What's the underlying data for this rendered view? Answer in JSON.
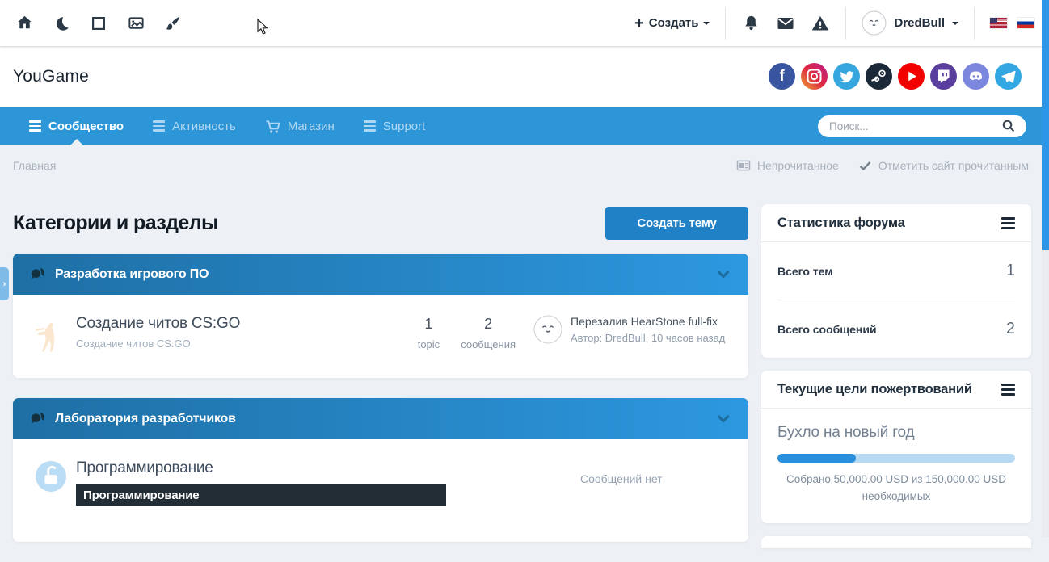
{
  "topbar": {
    "create_label": "Создать",
    "username": "DredBull"
  },
  "header": {
    "site_title": "YouGame",
    "social": [
      "facebook",
      "instagram",
      "twitter",
      "steam",
      "youtube",
      "twitch",
      "discord",
      "telegram"
    ]
  },
  "nav": {
    "items": [
      {
        "label": "Сообщество",
        "active": true
      },
      {
        "label": "Активность",
        "active": false
      },
      {
        "label": "Магазин",
        "active": false
      },
      {
        "label": "Support",
        "active": false
      }
    ],
    "search_placeholder": "Поиск..."
  },
  "breadcrumb": {
    "home": "Главная",
    "unread_label": "Непрочитанное",
    "mark_read_label": "Отметить сайт прочитанным"
  },
  "main": {
    "heading": "Категории и разделы",
    "create_topic_label": "Создать тему",
    "categories": [
      {
        "title": "Разработка игрового ПО",
        "forums": [
          {
            "title": "Создание читов CS:GO",
            "description": "Создание читов CS:GO",
            "stats": [
              {
                "value": "1",
                "label": "topic"
              },
              {
                "value": "2",
                "label": "сообщения"
              }
            ],
            "last_post": {
              "title": "Перезалив HearStone full-fix",
              "meta": "Автор: DredBull, 10 часов назад"
            }
          }
        ]
      },
      {
        "title": "Лаборатория разработчиков",
        "forums": [
          {
            "title": "Программирование",
            "description_redacted": "Программирование",
            "last_post_empty": "Сообщений нет"
          }
        ]
      }
    ]
  },
  "sidebar": {
    "widgets": [
      {
        "title": "Статистика форума",
        "rows": [
          {
            "label": "Всего тем",
            "value": "1"
          },
          {
            "label": "Всего сообщений",
            "value": "2"
          }
        ]
      },
      {
        "title": "Текущие цели пожертвований",
        "goal": {
          "name": "Бухло на новый год",
          "progress_percent": 33,
          "progress_text": "Собрано 50,000.00 USD из 150,000.00 USD необходимых"
        }
      }
    ]
  },
  "colors": {
    "accent": "#2d96d9",
    "category_gradient_start": "#1e6fa4",
    "category_gradient_end": "#2d98e0",
    "button": "#2181c7",
    "progress_fill": "#2a8fdc",
    "progress_track": "#b7d9f2",
    "redacted_bg": "#232d36",
    "scrollbar_thumb": "#2e96e6"
  }
}
